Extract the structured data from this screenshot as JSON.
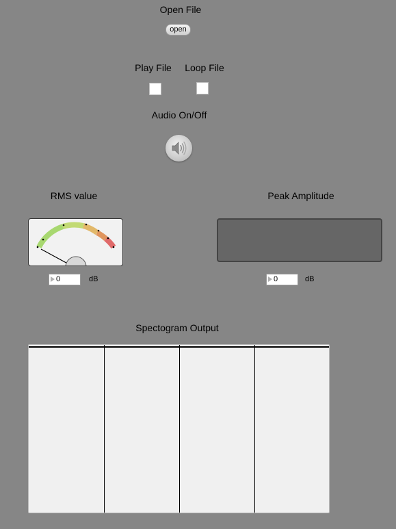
{
  "open_file": {
    "label": "Open File",
    "button_label": "open"
  },
  "play_file": {
    "label": "Play File",
    "checked": false
  },
  "loop_file": {
    "label": "Loop File",
    "checked": false
  },
  "audio": {
    "label": "Audio On/Off",
    "icon": "speaker-icon"
  },
  "rms": {
    "label": "RMS value",
    "value": "0",
    "unit": "dB",
    "meter_colors": [
      "#a8d870",
      "#c9d870",
      "#e2b86a",
      "#e08a5e",
      "#e06a6a"
    ]
  },
  "peak": {
    "label": "Peak Amplitude",
    "value": "0",
    "unit": "dB",
    "display_color": "#666666"
  },
  "spectrogram": {
    "label": "Spectogram Output",
    "background": "#f0f0f0"
  },
  "colors": {
    "background": "#868686"
  }
}
